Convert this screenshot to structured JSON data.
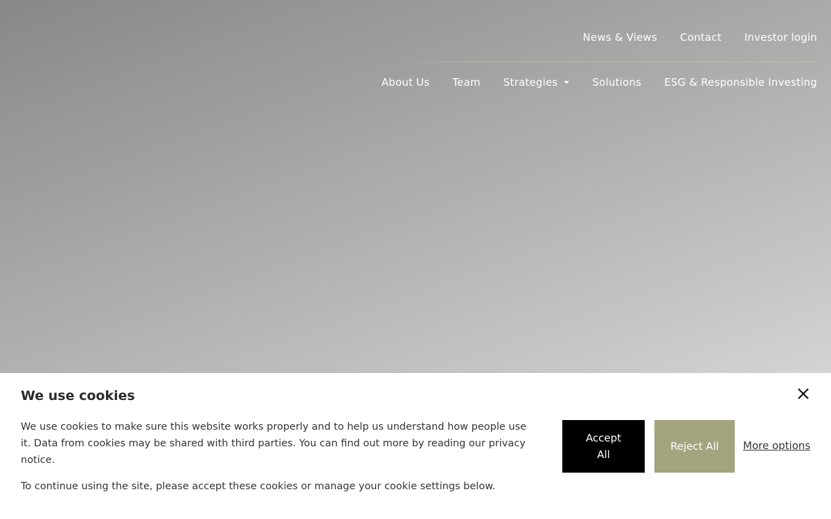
{
  "top_nav": [
    {
      "label": "News & Views"
    },
    {
      "label": "Contact"
    },
    {
      "label": "Investor login"
    }
  ],
  "main_nav": [
    {
      "label": "About Us"
    },
    {
      "label": "Team"
    },
    {
      "label": "Strategies",
      "icon": "chevron-down-icon"
    },
    {
      "label": "Solutions"
    },
    {
      "label": "ESG & Responsible Investing"
    }
  ],
  "cookie_banner": {
    "title": "We use cookies",
    "text1": "We use cookies to make sure this website works properly and to help us understand how people use it. Data from cookies may be shared with third parties. You can find out more by reading our privacy notice.",
    "text2": "To continue using the site, please accept these cookies or manage your cookie settings below.",
    "accept_label": "Accept All",
    "reject_label": "Reject All",
    "more_options_label": "More options",
    "close_icon": "close-icon"
  },
  "colors": {
    "accent": "#a4a47e",
    "accept_bg": "#000000"
  }
}
